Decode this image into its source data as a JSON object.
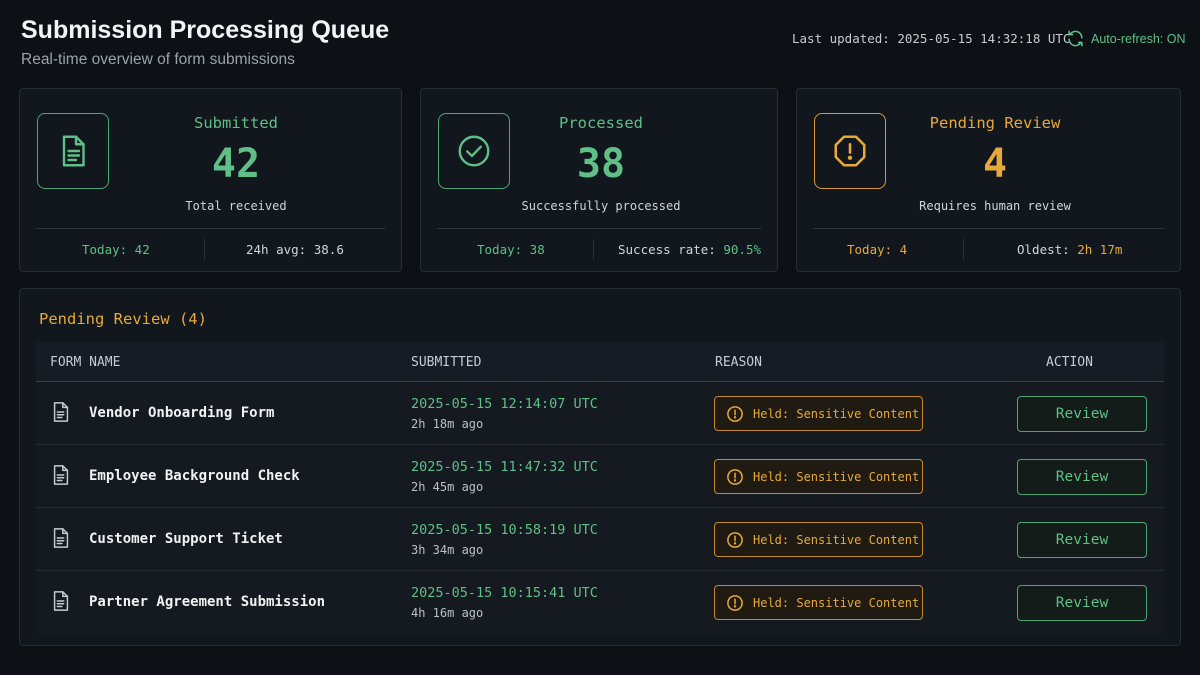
{
  "header": {
    "title": "Submission Processing Queue",
    "subtitle": "Real-time overview of form submissions",
    "last_updated": "Last updated: 2025-05-15 14:32:18 UTC",
    "auto_refresh": "Auto-refresh: ON"
  },
  "cards": [
    {
      "label": "Submitted",
      "value": "42",
      "desc": "Total received",
      "left_stat": "Today: 42",
      "right_label": "24h avg:",
      "right_value": "38.6",
      "icon": "document-icon"
    },
    {
      "label": "Processed",
      "value": "38",
      "desc": "Successfully processed",
      "left_stat": "Today: 38",
      "right_label": "Success rate:",
      "right_value": "90.5%",
      "icon": "check-circle-icon"
    },
    {
      "label": "Pending Review",
      "value": "4",
      "desc": "Requires human review",
      "left_stat": "Today: 4",
      "right_label": "Oldest:",
      "right_value": "2h 17m",
      "icon": "alert-octagon-icon"
    }
  ],
  "pending": {
    "title": "Pending Review (4)",
    "columns": [
      "FORM NAME",
      "SUBMITTED",
      "REASON",
      "ACTION"
    ],
    "rows": [
      {
        "name": "Vendor Onboarding Form",
        "submitted": "2025-05-15 12:14:07 UTC",
        "ago": "2h 18m ago",
        "reason": "Held: Sensitive Content",
        "action": "Review"
      },
      {
        "name": "Employee Background Check",
        "submitted": "2025-05-15 11:47:32 UTC",
        "ago": "2h 45m ago",
        "reason": "Held: Sensitive Content",
        "action": "Review"
      },
      {
        "name": "Customer Support Ticket",
        "submitted": "2025-05-15 10:58:19 UTC",
        "ago": "3h 34m ago",
        "reason": "Held: Sensitive Content",
        "action": "Review"
      },
      {
        "name": "Partner Agreement Submission",
        "submitted": "2025-05-15 10:15:41 UTC",
        "ago": "4h 16m ago",
        "reason": "Held: Sensitive Content",
        "action": "Review"
      }
    ]
  },
  "colors": {
    "background": "#0d1116",
    "accent_green": "#5fbf87",
    "accent_amber": "#e7a93b"
  }
}
